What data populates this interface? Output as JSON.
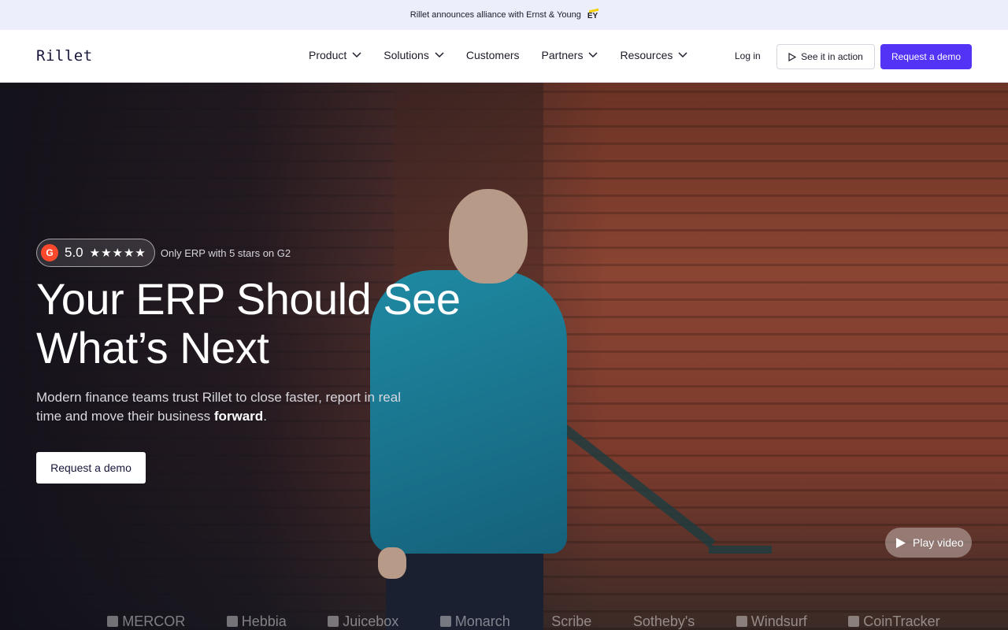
{
  "announcement": {
    "text": "Rillet announces alliance with Ernst & Young",
    "partner_logo": "EY"
  },
  "nav": {
    "logo": "Rillet",
    "menu": [
      {
        "label": "Product",
        "dropdown": true
      },
      {
        "label": "Solutions",
        "dropdown": true
      },
      {
        "label": "Customers",
        "dropdown": false
      },
      {
        "label": "Partners",
        "dropdown": true
      },
      {
        "label": "Resources",
        "dropdown": true
      }
    ],
    "login": "Log in",
    "see_action": "See it in action",
    "request_demo": "Request a demo"
  },
  "hero": {
    "rating": "5.0",
    "stars": "★★★★★",
    "g2": "G",
    "badge_text": "Only ERP with 5 stars on G2",
    "headline_line1": "Your ERP Should See",
    "headline_line2": "What’s Next",
    "subtext_main": "Modern finance teams trust Rillet to close faster, report in real time and move their business ",
    "subtext_bold": "forward",
    "subtext_end": ".",
    "cta": "Request a demo",
    "play": "Play video"
  },
  "customer_logos": [
    "MERCOR",
    "Hebbia",
    "Juicebox",
    "Monarch",
    "Scribe",
    "Sotheby's",
    "Windsurf",
    "CoinTracker"
  ],
  "colors": {
    "accent": "#5333f5",
    "g2": "#ff492c",
    "announce_bg": "#eceefb"
  }
}
